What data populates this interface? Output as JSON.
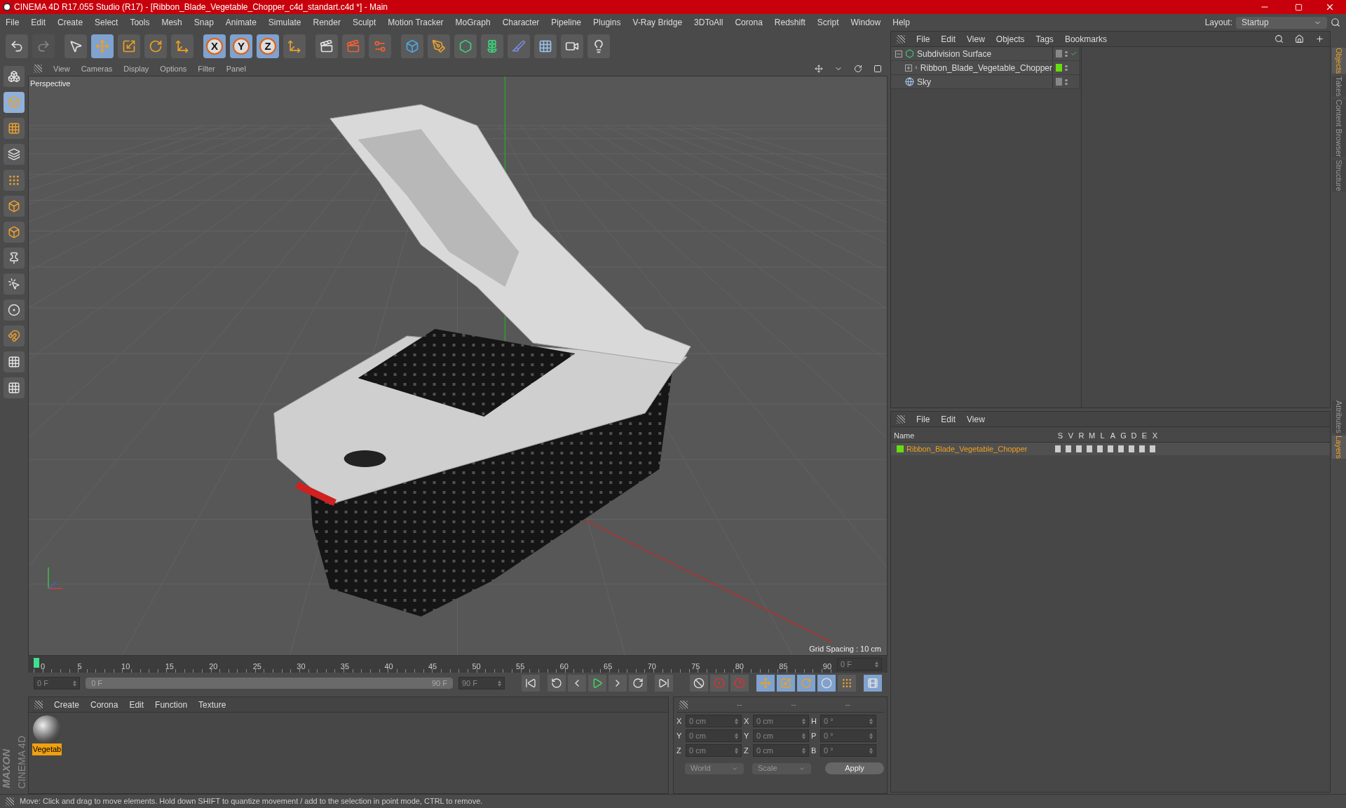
{
  "window": {
    "title": "CINEMA 4D R17.055 Studio (R17) - [Ribbon_Blade_Vegetable_Chopper_c4d_standart.c4d *] - Main"
  },
  "menu": [
    "File",
    "Edit",
    "Create",
    "Select",
    "Tools",
    "Mesh",
    "Snap",
    "Animate",
    "Simulate",
    "Render",
    "Sculpt",
    "Motion Tracker",
    "MoGraph",
    "Character",
    "Pipeline",
    "Plugins",
    "V-Ray Bridge",
    "3DToAll",
    "Corona",
    "Redshift",
    "Script",
    "Window",
    "Help"
  ],
  "layout": {
    "label": "Layout:",
    "value": "Startup"
  },
  "toolbar": [
    {
      "kind": "undo",
      "selected": false,
      "disabled": false
    },
    {
      "kind": "redo",
      "selected": false,
      "disabled": true
    },
    {
      "kind": "select",
      "selected": false,
      "disabled": false
    },
    {
      "kind": "move",
      "selected": true,
      "disabled": false
    },
    {
      "kind": "scale",
      "selected": false,
      "disabled": false
    },
    {
      "kind": "rotate",
      "selected": false,
      "disabled": false
    },
    {
      "kind": "transform",
      "selected": false,
      "disabled": false
    },
    {
      "kind": "axis",
      "label": "X",
      "selected": true,
      "disabled": false
    },
    {
      "kind": "axis",
      "label": "Y",
      "selected": true,
      "disabled": false
    },
    {
      "kind": "axis",
      "label": "Z",
      "selected": true,
      "disabled": false
    },
    {
      "kind": "coords",
      "selected": false,
      "disabled": false
    },
    {
      "kind": "render_view",
      "selected": false,
      "disabled": false
    },
    {
      "kind": "render_picture",
      "selected": false,
      "disabled": false
    },
    {
      "kind": "render_settings",
      "selected": false,
      "disabled": false
    },
    {
      "kind": "cube",
      "selected": false,
      "disabled": false
    },
    {
      "kind": "pen",
      "selected": false,
      "disabled": false
    },
    {
      "kind": "subdivision",
      "selected": false,
      "disabled": false
    },
    {
      "kind": "cloner",
      "selected": false,
      "disabled": false
    },
    {
      "kind": "deformer",
      "selected": false,
      "disabled": false
    },
    {
      "kind": "floor",
      "selected": false,
      "disabled": false
    },
    {
      "kind": "camera",
      "selected": false,
      "disabled": false
    },
    {
      "kind": "light",
      "selected": false,
      "disabled": false
    }
  ],
  "left_toolbar": [
    {
      "kind": "make_editable",
      "selected": false
    },
    {
      "kind": "model",
      "selected": true
    },
    {
      "kind": "texture",
      "selected": false
    },
    {
      "kind": "workplane",
      "selected": false
    },
    {
      "kind": "points",
      "selected": false
    },
    {
      "kind": "edges",
      "selected": false
    },
    {
      "kind": "polygons",
      "selected": false
    },
    {
      "kind": "axis",
      "selected": false
    },
    {
      "kind": "tweak",
      "selected": false
    },
    {
      "kind": "solo",
      "selected": false
    },
    {
      "kind": "snap",
      "selected": false
    },
    {
      "kind": "grid_lock",
      "selected": false
    },
    {
      "kind": "grid_anim",
      "selected": false
    }
  ],
  "logo": {
    "brand": "MAXON",
    "product": "CINEMA 4D"
  },
  "viewport": {
    "menu": [
      "View",
      "Cameras",
      "Display",
      "Options",
      "Filter",
      "Panel"
    ],
    "camera": "Perspective",
    "grid_spacing": "Grid Spacing : 10 cm"
  },
  "timeline": {
    "ruler_labels": [
      "0",
      "5",
      "10",
      "15",
      "20",
      "25",
      "30",
      "35",
      "40",
      "45",
      "50",
      "55",
      "60",
      "65",
      "70",
      "75",
      "80",
      "85",
      "90"
    ],
    "frame_field": "0 F",
    "start_field": "0 F",
    "range": {
      "start": "0 F",
      "end": "90 F",
      "level": 1
    },
    "end_field": "90 F",
    "playback": [
      {
        "kind": "first"
      },
      {
        "kind": "prev_key"
      },
      {
        "kind": "prev_frame"
      },
      {
        "kind": "play"
      },
      {
        "kind": "next_frame"
      },
      {
        "kind": "next_key"
      },
      {
        "kind": "last"
      }
    ],
    "tools": [
      {
        "kind": "record_off",
        "selected": false
      },
      {
        "kind": "record",
        "selected": false
      },
      {
        "kind": "autokey",
        "selected": false
      },
      {
        "kind": "move",
        "selected": true
      },
      {
        "kind": "scale",
        "selected": true
      },
      {
        "kind": "rotate",
        "selected": true
      },
      {
        "kind": "param",
        "selected": true
      },
      {
        "kind": "points",
        "selected": false
      },
      {
        "kind": "film",
        "selected": true
      }
    ]
  },
  "materials": {
    "menu": [
      "Create",
      "Corona",
      "Edit",
      "Function",
      "Texture"
    ],
    "items": [
      {
        "name": "Vegetab",
        "selected": true
      }
    ]
  },
  "coordinates": {
    "headers": [
      "--",
      "--",
      "--"
    ],
    "rows": [
      {
        "a": "X",
        "a_value": "0 cm",
        "b": "X",
        "b_value": "0 cm",
        "c": "H",
        "c_value": "0 °"
      },
      {
        "a": "Y",
        "a_value": "0 cm",
        "b": "Y",
        "b_value": "0 cm",
        "c": "P",
        "c_value": "0 °"
      },
      {
        "a": "Z",
        "a_value": "0 cm",
        "b": "Z",
        "b_value": "0 cm",
        "c": "B",
        "c_value": "0 °"
      }
    ],
    "mode": "World",
    "transform": "Scale",
    "apply": "Apply"
  },
  "objects_panel": {
    "menu": [
      "File",
      "Edit",
      "View",
      "Objects",
      "Tags",
      "Bookmarks"
    ],
    "objects": [
      {
        "name": "Subdivision Surface",
        "kind": "subdivision",
        "expanded": true,
        "checked": true,
        "color": "#888888",
        "children": [
          {
            "name": "Ribbon_Blade_Vegetable_Chopper",
            "kind": "null",
            "expanded": false,
            "checked": false,
            "color": "#66dd11"
          }
        ]
      },
      {
        "name": "Sky",
        "kind": "sky",
        "checked": false,
        "color": "#888888"
      }
    ]
  },
  "layers_panel": {
    "menu": [
      "File",
      "Edit",
      "View"
    ],
    "columns": [
      "Name",
      "S",
      "V",
      "R",
      "M",
      "L",
      "A",
      "G",
      "D",
      "E",
      "X"
    ],
    "rows": [
      {
        "name": "Ribbon_Blade_Vegetable_Chopper",
        "color": "#66dd11"
      }
    ]
  },
  "side_tabs_top": [
    {
      "label": "Objects",
      "selected": true
    },
    {
      "label": "Takes",
      "selected": false
    },
    {
      "label": "Content Browser",
      "selected": false
    },
    {
      "label": "Structure",
      "selected": false
    }
  ],
  "side_tabs_bottom": [
    {
      "label": "Attributes",
      "selected": false
    },
    {
      "label": "Layers",
      "selected": true
    }
  ],
  "status_bar": "Move: Click and drag to move elements. Hold down SHIFT to quantize movement / add to the selection in point mode, CTRL to remove."
}
